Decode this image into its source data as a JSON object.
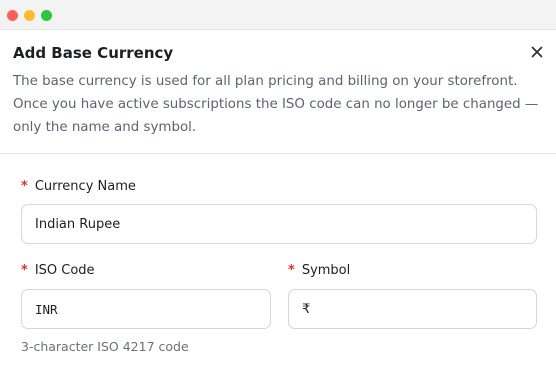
{
  "window": {
    "controls": [
      "close",
      "minimize",
      "zoom"
    ]
  },
  "dialog": {
    "title": "Add Base Currency",
    "description": "The base currency is used for all plan pricing and billing on your storefront. Once you have active subscriptions the ISO code can no longer be changed — only the name and symbol.",
    "close_icon": "close-icon"
  },
  "form": {
    "required_marker": "*",
    "currency_name": {
      "label": "Currency Name",
      "value": "Indian Rupee"
    },
    "iso_code": {
      "label": "ISO Code",
      "value": "INR",
      "hint": "3-character ISO 4217 code"
    },
    "symbol": {
      "label": "Symbol",
      "value": "₹"
    }
  },
  "colors": {
    "required": "#e0332f",
    "window_close": "#ff5f57",
    "window_minimize": "#febc2e",
    "window_zoom": "#28c840"
  }
}
